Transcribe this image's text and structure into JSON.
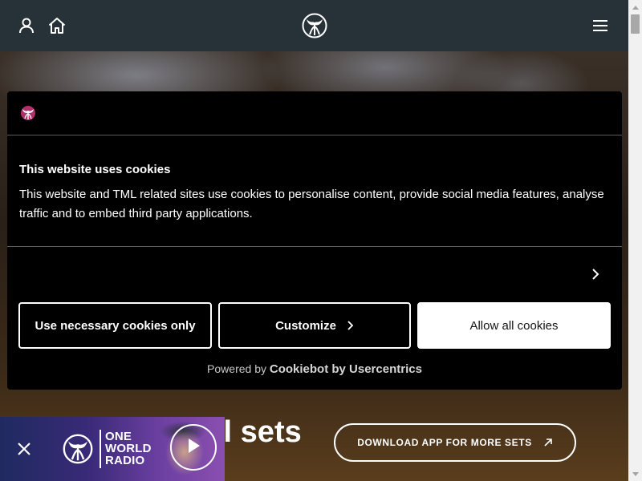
{
  "header": {
    "account_icon": "user-icon",
    "home_icon": "home-icon",
    "logo_icon": "tomorrowland-logo-icon",
    "menu_icon": "hamburger-menu-icon"
  },
  "hero": {
    "title_visible": "ll sets",
    "download_label": "DOWNLOAD APP FOR MORE SETS",
    "download_icon": "arrow-up-right-icon"
  },
  "radio": {
    "name_line1": "ONE",
    "name_line2": "WORLD",
    "name_line3": "RADIO",
    "close_icon": "close-icon",
    "play_icon": "play-icon"
  },
  "cookie": {
    "logo_icon": "tomorrowland-logo-icon",
    "title": "This website uses cookies",
    "text": "This website and TML related sites use cookies to personalise content, provide social media features, analyse traffic and to embed third party applications.",
    "details_icon": "chevron-right-icon",
    "necessary_label": "Use necessary cookies only",
    "customize_label": "Customize",
    "allow_label": "Allow all cookies",
    "powered_prefix": "Powered by",
    "powered_brand": "Cookiebot by Usercentrics"
  },
  "colors": {
    "topbar": "#263238",
    "modal_bg": "#000000",
    "allow_bg": "#ffffff"
  }
}
